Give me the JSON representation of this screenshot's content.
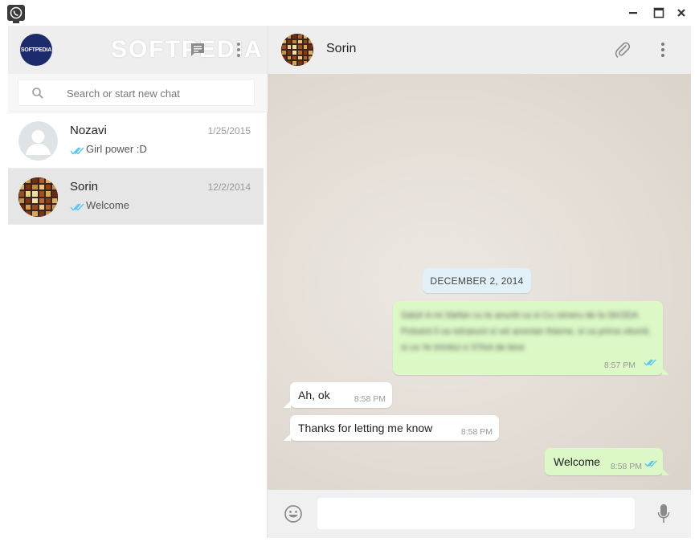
{
  "window": {
    "app_icon": "whatsapp-icon",
    "controls": {
      "minimize": "minimize-icon",
      "maximize": "maximize-icon",
      "close": "close-icon"
    }
  },
  "sidebar": {
    "profile": {
      "avatar_text": "SOFTPEDIA"
    },
    "watermark": "SOFTPEDIA",
    "search": {
      "placeholder": "Search or start new chat",
      "value": ""
    },
    "chats": [
      {
        "name": "Nozavi",
        "date": "1/25/2015",
        "preview": "Girl power :D",
        "active": false
      },
      {
        "name": "Sorin",
        "date": "12/2/2014",
        "preview": "Welcome",
        "active": true
      }
    ]
  },
  "conversation": {
    "contact_name": "Sorin",
    "date_separator": "DECEMBER 2, 2014",
    "messages": [
      {
        "direction": "out",
        "text": "Salut! A mi Stefan cu te anuntt ca si Cu nimeru de la SKODA Poissint il va retrasunt si vei anonian thieme, si ca prima vitumil, si ca Ye trimitul ci STAA de bine",
        "time": "8:57 PM",
        "blurred": true
      },
      {
        "direction": "in",
        "text": "Ah, ok",
        "time": "8:58 PM"
      },
      {
        "direction": "in",
        "text": "Thanks for letting me know",
        "time": "8:58 PM"
      },
      {
        "direction": "out",
        "text": "Welcome",
        "time": "8:58 PM"
      }
    ],
    "composer": {
      "placeholder": "",
      "value": ""
    }
  },
  "colors": {
    "header_bg": "#eeeeee",
    "outgoing_bubble": "#dcf8c6",
    "incoming_bubble": "#ffffff",
    "read_tick": "#4fc3f7",
    "date_chip": "#e1f1f7"
  }
}
